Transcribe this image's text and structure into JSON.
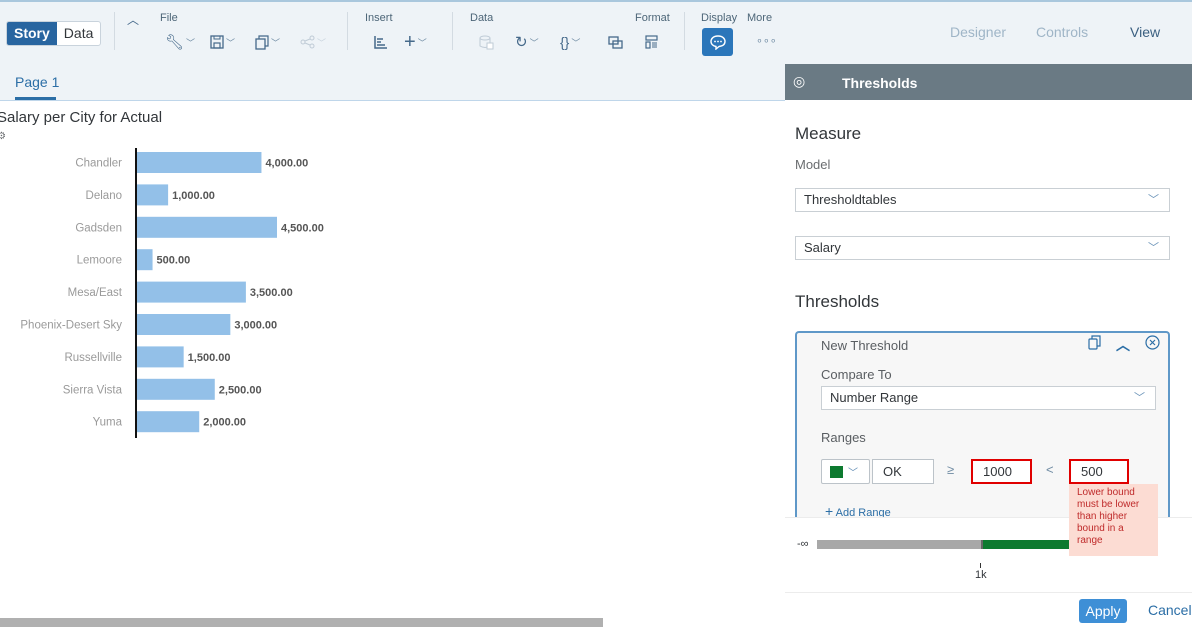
{
  "toolbar": {
    "mode_tabs": [
      {
        "label": "Story",
        "active": true
      },
      {
        "label": "Data",
        "active": false
      }
    ],
    "groups": {
      "file": "File",
      "insert": "Insert",
      "data": "Data",
      "format": "Format",
      "display": "Display",
      "more": "More"
    },
    "more_glyph": "∘∘∘",
    "view_tabs": [
      {
        "label": "Designer",
        "active": false
      },
      {
        "label": "Controls",
        "active": false
      },
      {
        "label": "View",
        "active": true
      }
    ]
  },
  "page_tabs": [
    {
      "label": "Page 1",
      "active": true
    }
  ],
  "chart": {
    "title": "Salary per City for Actual",
    "bar_color": "#93c0e8"
  },
  "chart_data": {
    "type": "bar",
    "orientation": "horizontal",
    "title": "Salary per City for Actual",
    "categories": [
      "Chandler",
      "Delano",
      "Gadsden",
      "Lemoore",
      "Mesa/East",
      "Phoenix-Desert Sky",
      "Russellville",
      "Sierra Vista",
      "Yuma"
    ],
    "values": [
      4000,
      1000,
      4500,
      500,
      3500,
      3000,
      1500,
      2500,
      2000
    ],
    "data_labels": [
      "4,000.00",
      "1,000.00",
      "4,500.00",
      "500.00",
      "3,500.00",
      "3,000.00",
      "1,500.00",
      "2,500.00",
      "2,000.00"
    ],
    "xlabel": "",
    "ylabel": "",
    "xlim": [
      0,
      4500
    ],
    "grid": false,
    "legend": "none"
  },
  "panel": {
    "title": "Thresholds",
    "measure_heading": "Measure",
    "model_label": "Model",
    "model_value": "Thresholdtables",
    "measure_value": "Salary",
    "thresholds_heading": "Thresholds",
    "threshold": {
      "name": "New Threshold",
      "compare_to_label": "Compare To",
      "compare_to_value": "Number Range",
      "ranges_label": "Ranges",
      "range": {
        "color": "#0d7a2f",
        "name": "OK",
        "lower_op": "≥",
        "lower": "1000",
        "upper_op": "<",
        "upper": "500"
      },
      "error_tooltip": "Lower bound must be lower than higher bound in a range",
      "add_range": "Add Range"
    },
    "scale": {
      "start_label": "-∞",
      "tick_label": "1k"
    },
    "apply": "Apply",
    "cancel": "Cancel"
  }
}
